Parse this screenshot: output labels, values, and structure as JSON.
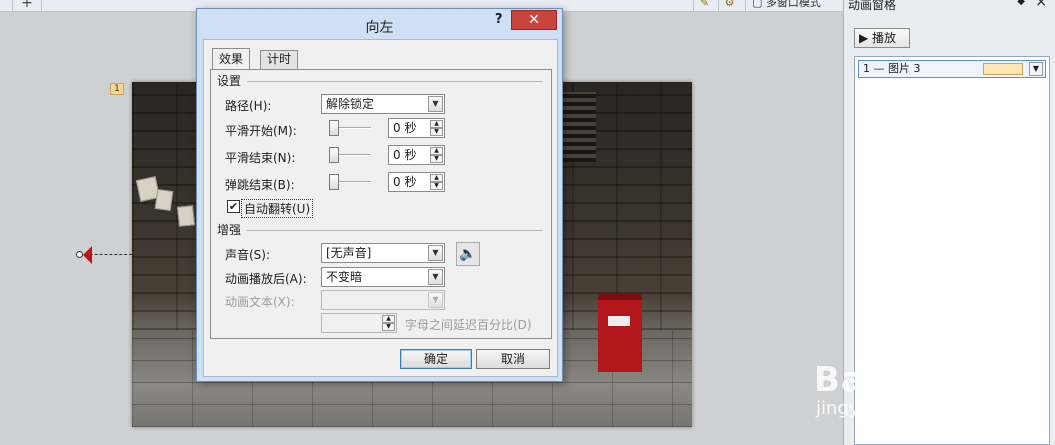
{
  "toolbar": {
    "plus_label": "+",
    "multi_window_label": "多窗口模式"
  },
  "pane": {
    "title": "动画窗格",
    "play_label": "播放",
    "items": [
      {
        "text": "1 — 图片 3"
      }
    ]
  },
  "slide": {
    "badge": "1"
  },
  "dialog": {
    "title": "向左",
    "help": "?",
    "close": "✕",
    "tabs": [
      {
        "label": "效果"
      },
      {
        "label": "计时"
      }
    ],
    "settings": {
      "group_label": "设置",
      "path_label": "路径(H):",
      "path_value": "解除锁定",
      "smooth_start_label": "平滑开始(M):",
      "smooth_start_value": "0 秒",
      "smooth_end_label": "平滑结束(N):",
      "smooth_end_value": "0 秒",
      "bounce_end_label": "弹跳结束(B):",
      "bounce_end_value": "0 秒",
      "auto_reverse_label": "自动翻转(U)",
      "auto_reverse_checked": true
    },
    "enhance": {
      "group_label": "增强",
      "sound_label": "声音(S):",
      "sound_value": "[无声音]",
      "after_anim_label": "动画播放后(A):",
      "after_anim_value": "不变暗",
      "anim_text_label": "动画文本(X):",
      "anim_text_value": "",
      "delay_value": "",
      "delay_label": "字母之间延迟百分比(D)"
    },
    "ok_label": "确定",
    "cancel_label": "取消"
  },
  "watermark": {
    "line1": "Bai du 经验",
    "line2": "jingyan.baidu.com"
  }
}
